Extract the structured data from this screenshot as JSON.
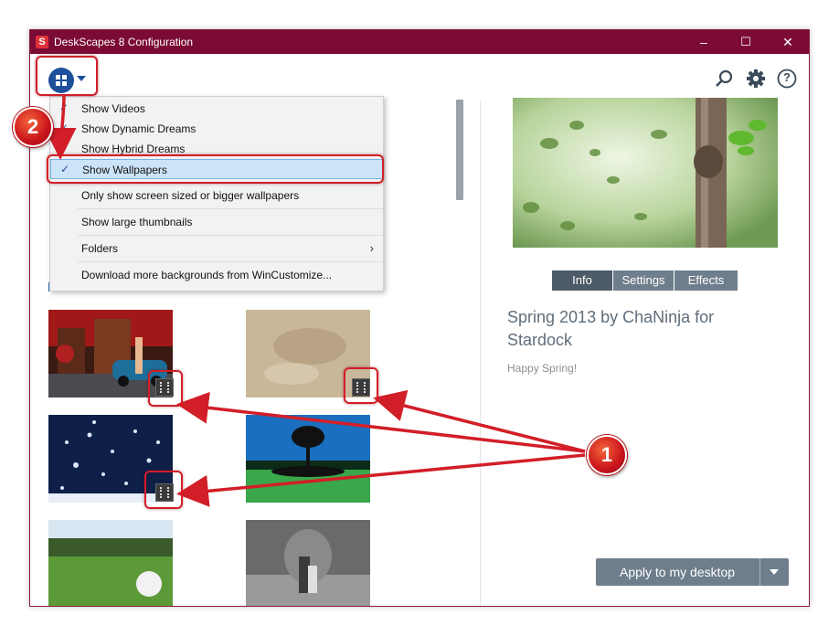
{
  "window": {
    "title": "DeskScapes 8 Configuration",
    "app_icon": "deskscapes-logo-icon",
    "controls": {
      "minimize": "–",
      "maximize": "☐",
      "close": "✕"
    }
  },
  "toolbar": {
    "view_button_icon": "view-options-icon",
    "search_icon": "search-icon",
    "settings_icon": "gear-icon",
    "help_icon": "help-icon",
    "help_glyph": "?"
  },
  "menu": {
    "items": [
      {
        "label": "Show Videos",
        "checked": true
      },
      {
        "label": "Show Dynamic Dreams",
        "checked": true
      },
      {
        "label": "Show Hybrid Dreams",
        "checked": true
      },
      {
        "label": "Show Wallpapers",
        "checked": true,
        "highlighted": true
      },
      {
        "label": "Only show screen sized or bigger wallpapers",
        "checked": false
      },
      {
        "label": "Show large thumbnails",
        "checked": false
      },
      {
        "label": "Folders",
        "checked": false,
        "submenu": true
      },
      {
        "label": "Download more backgrounds from WinCustomize...",
        "checked": false
      }
    ],
    "check_glyph": "✓",
    "submenu_glyph": "›"
  },
  "annotations": {
    "badge_1": "1",
    "badge_2": "2",
    "color": "#d21e28"
  },
  "detail": {
    "tabs": [
      "Info",
      "Settings",
      "Effects"
    ],
    "active_tab": "Info",
    "title": "Spring 2013 by ChaNinja for Stardock",
    "description": "Happy Spring!",
    "apply_button": "Apply to my desktop"
  },
  "colors": {
    "titlebar": "#7b0b34",
    "accent": "#1f4f9a",
    "button": "#6f7e8c",
    "highlight_red": "#d21e28"
  }
}
